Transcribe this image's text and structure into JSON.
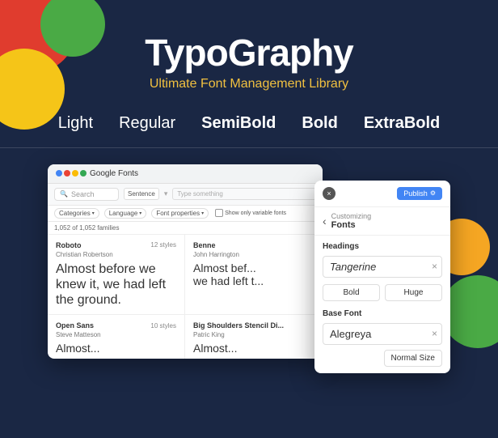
{
  "app": {
    "title": "TypoGraphy",
    "subtitle": "Ultimate Font Management Library"
  },
  "font_weights": [
    {
      "label": "Light",
      "class": "fw-light"
    },
    {
      "label": "Regular",
      "class": "fw-regular"
    },
    {
      "label": "SemiBold",
      "class": "fw-semibold"
    },
    {
      "label": "Bold",
      "class": "fw-bold"
    },
    {
      "label": "ExtraBold",
      "class": "fw-extrabold"
    }
  ],
  "google_fonts": {
    "title": "Google Fonts",
    "search_placeholder": "Search",
    "sentence_label": "Sentence",
    "type_placeholder": "Type something",
    "filters": [
      "Categories",
      "Language",
      "Font properties"
    ],
    "show_variable": "Show only variable fonts",
    "results_count": "1,052 of 1,052 families",
    "fonts": [
      {
        "name": "Roboto",
        "designer": "Christian Robertson",
        "styles": "12 styles",
        "preview": "Almost before we knew it, we had left the ground."
      },
      {
        "name": "Benne",
        "designer": "John Harrington",
        "styles": "",
        "preview": "Almost bef... we had left t..."
      },
      {
        "name": "Open Sans",
        "designer": "Steve Matteson",
        "styles": "10 styles",
        "preview": "Almost..."
      },
      {
        "name": "Big Shoulders Stencil Di...",
        "designer": "Patric King",
        "styles": "",
        "preview": "Almost..."
      }
    ]
  },
  "customize_panel": {
    "close_icon": "×",
    "publish_label": "Publish",
    "back_icon": "‹",
    "nav_label": "Customizing",
    "title": "Fonts",
    "headings_label": "Headings",
    "headings_font": "Tangerine",
    "bold_btn": "Bold",
    "huge_btn": "Huge",
    "base_font_label": "Base Font",
    "base_font": "Alegreya",
    "normal_size_btn": "Normal Size"
  },
  "colors": {
    "background": "#1a2744",
    "accent_yellow": "#f0c040",
    "publish_blue": "#4285f4",
    "circle_red": "#e03c2e",
    "circle_green": "#4aaa45",
    "circle_yellow": "#f5c518",
    "circle_orange": "#f5a623"
  }
}
